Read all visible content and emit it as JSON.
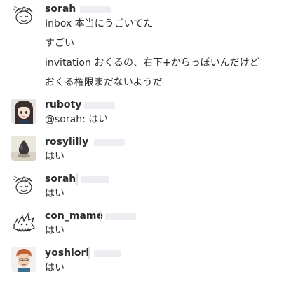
{
  "messages": [
    {
      "author": "sorah",
      "avatar_icon": "sketch-face-icon",
      "lines": [
        "Inbox 本当にうごいてた",
        "すごい",
        "invitation おくるの、右下+からっぽいんだけど",
        "おくる権限まだないようだ"
      ]
    },
    {
      "author": "ruboty",
      "avatar_icon": "anime-girl-icon",
      "lines": [
        "@sorah: はい"
      ]
    },
    {
      "author": "rosylilly",
      "avatar_icon": "figurine-icon",
      "lines": [
        "はい"
      ]
    },
    {
      "author": "sorah",
      "avatar_icon": "sketch-face-icon",
      "lines": [
        "はい"
      ]
    },
    {
      "author": "con_mame",
      "avatar_icon": "spiky-creature-icon",
      "lines": [
        "はい"
      ]
    },
    {
      "author": "yoshiori",
      "avatar_icon": "cartoon-man-icon",
      "lines": [
        "はい"
      ]
    }
  ]
}
